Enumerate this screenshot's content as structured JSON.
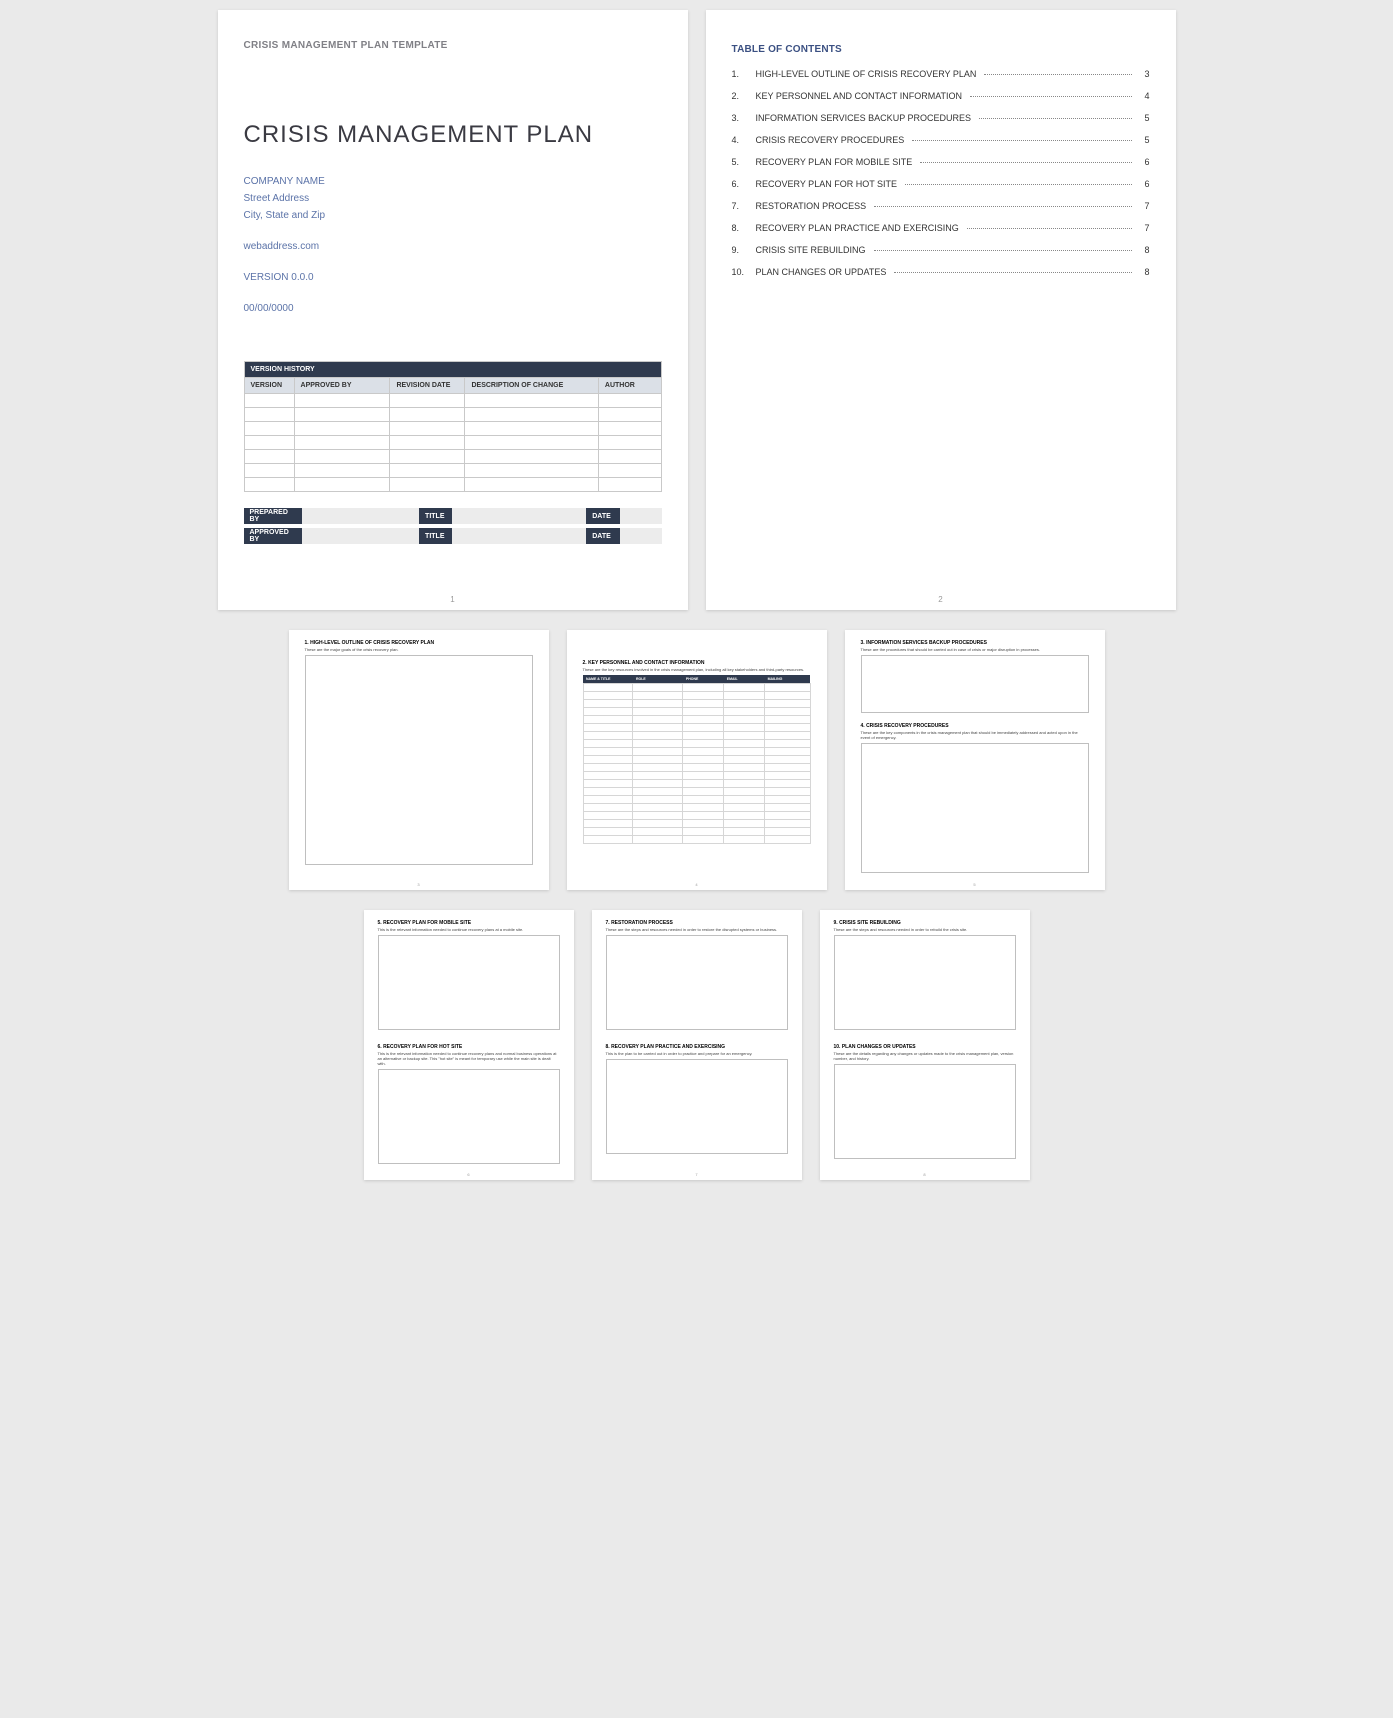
{
  "page1": {
    "header": "CRISIS MANAGEMENT PLAN TEMPLATE",
    "title": "CRISIS MANAGEMENT PLAN",
    "company": "COMPANY NAME",
    "street": "Street Address",
    "citystate": "City, State and Zip",
    "web": "webaddress.com",
    "version": "VERSION 0.0.0",
    "date": "00/00/0000",
    "vhist_banner": "VERSION HISTORY",
    "vhist_cols": [
      "VERSION",
      "APPROVED BY",
      "REVISION DATE",
      "DESCRIPTION OF CHANGE",
      "AUTHOR"
    ],
    "sig": {
      "prepared": "PREPARED BY",
      "approved": "APPROVED BY",
      "title": "TITLE",
      "date": "DATE"
    },
    "pn": "1"
  },
  "page2": {
    "toc_title": "TABLE OF CONTENTS",
    "items": [
      {
        "n": "1.",
        "t": "HIGH-LEVEL OUTLINE OF CRISIS RECOVERY PLAN",
        "p": "3"
      },
      {
        "n": "2.",
        "t": "KEY PERSONNEL AND CONTACT INFORMATION",
        "p": "4"
      },
      {
        "n": "3.",
        "t": "INFORMATION SERVICES BACKUP PROCEDURES",
        "p": "5"
      },
      {
        "n": "4.",
        "t": "CRISIS RECOVERY PROCEDURES",
        "p": "5"
      },
      {
        "n": "5.",
        "t": "RECOVERY PLAN FOR MOBILE SITE",
        "p": "6"
      },
      {
        "n": "6.",
        "t": "RECOVERY PLAN FOR HOT SITE",
        "p": "6"
      },
      {
        "n": "7.",
        "t": "RESTORATION PROCESS",
        "p": "7"
      },
      {
        "n": "8.",
        "t": "RECOVERY PLAN PRACTICE AND EXERCISING",
        "p": "7"
      },
      {
        "n": "9.",
        "t": "CRISIS SITE REBUILDING",
        "p": "8"
      },
      {
        "n": "10.",
        "t": "PLAN CHANGES OR UPDATES",
        "p": "8"
      }
    ],
    "pn": "2"
  },
  "thumb3": {
    "num": "1.",
    "title": "HIGH-LEVEL OUTLINE OF CRISIS RECOVERY PLAN",
    "desc": "These are the major goals of the crisis recovery plan.",
    "pn": "3"
  },
  "thumb4": {
    "num": "2.",
    "title": "KEY PERSONNEL AND CONTACT INFORMATION",
    "desc": "These are the key resources involved in the crisis management plan, including all key stakeholders and third-party resources.",
    "cols": [
      "NAME & TITLE",
      "ROLE",
      "PHONE",
      "EMAIL",
      "MAILING"
    ],
    "pn": "4"
  },
  "thumb5": {
    "a_num": "3.",
    "a_title": "INFORMATION SERVICES BACKUP PROCEDURES",
    "a_desc": "These are the procedures that should be carried out in case of crisis or major disruption in processes.",
    "b_num": "4.",
    "b_title": "CRISIS RECOVERY PROCEDURES",
    "b_desc": "These are the key components in the crisis management plan that should be immediately addressed and acted upon in the event of emergency.",
    "pn": "5"
  },
  "thumb6": {
    "a_num": "5.",
    "a_title": "RECOVERY PLAN FOR MOBILE SITE",
    "a_desc": "This is the relevant information needed to continue recovery plans at a mobile site.",
    "b_num": "6.",
    "b_title": "RECOVERY PLAN FOR HOT SITE",
    "b_desc": "This is the relevant information needed to continue recovery plans and normal business operations at an alternative or backup site. This \"hot site\" is meant for temporary use while the main site is dealt with.",
    "pn": "6"
  },
  "thumb7": {
    "a_num": "7.",
    "a_title": "RESTORATION PROCESS",
    "a_desc": "These are the steps and resources needed in order to restore the disrupted systems or business.",
    "b_num": "8.",
    "b_title": "RECOVERY PLAN PRACTICE AND EXERCISING",
    "b_desc": "This is the plan to be carried out in order to practice and prepare for an emergency.",
    "pn": "7"
  },
  "thumb8": {
    "a_num": "9.",
    "a_title": "CRISIS SITE REBUILDING",
    "a_desc": "These are the steps and resources needed in order to rebuild the crisis site.",
    "b_num": "10.",
    "b_title": "PLAN CHANGES OR UPDATES",
    "b_desc": "These are the details regarding any changes or updates made to the crisis management plan, version number, and history.",
    "pn": "8"
  }
}
